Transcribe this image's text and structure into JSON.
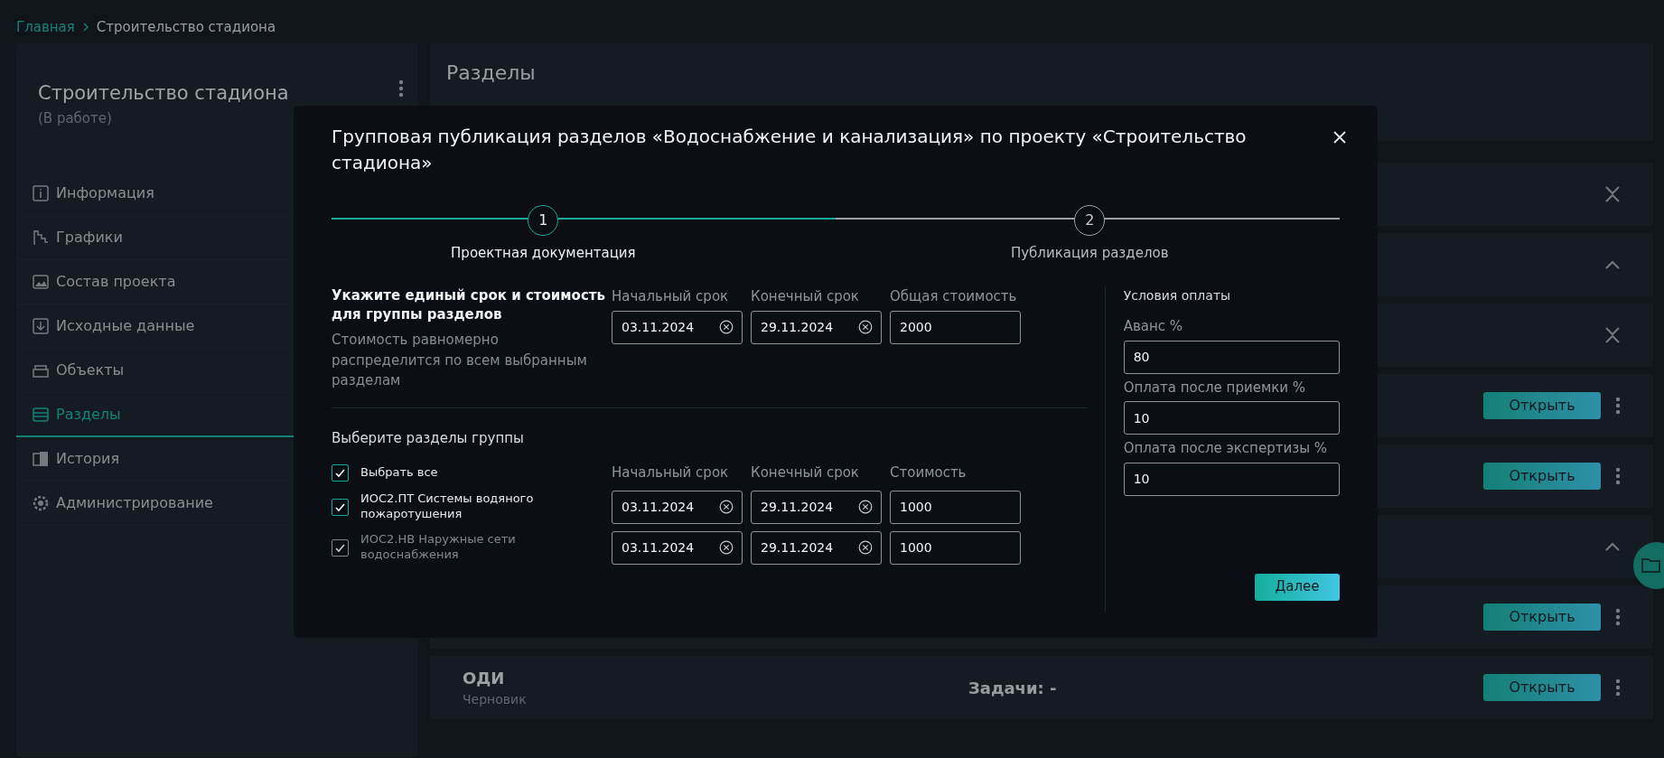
{
  "breadcrumb": [
    {
      "label": "Главная",
      "kind": "link"
    },
    {
      "label": "Строительство стадиона",
      "kind": "current"
    }
  ],
  "sidebar": {
    "title": "Строительство стадиона",
    "status": "(В работе)",
    "items": [
      {
        "label": "Информация",
        "selected": false
      },
      {
        "label": "Графики",
        "selected": false
      },
      {
        "label": "Состав проекта",
        "selected": false
      },
      {
        "label": "Исходные данные",
        "selected": false
      },
      {
        "label": "Объекты",
        "selected": false
      },
      {
        "label": "Разделы",
        "selected": true
      },
      {
        "label": "История",
        "selected": false
      },
      {
        "label": "Администрирование",
        "selected": false
      }
    ]
  },
  "main": {
    "title": "Разделы",
    "rows": [
      {
        "kind": "group",
        "expanded": false
      },
      {
        "kind": "group",
        "expanded": true
      },
      {
        "kind": "group",
        "expanded": false
      },
      {
        "kind": "section",
        "button": "Открыть"
      },
      {
        "kind": "section",
        "button": "Открыть"
      },
      {
        "kind": "group",
        "expanded": true
      },
      {
        "kind": "section",
        "button": "Открыть"
      },
      {
        "kind": "section",
        "name": "ОДИ",
        "status": "Черновик",
        "tasks": "Задачи: -",
        "button": "Открыть"
      }
    ]
  },
  "dialog": {
    "title": "Групповая публикация разделов «Водоснабжение и канализация» по проекту «Строительство стадиона»",
    "steps": [
      {
        "number": "1",
        "label": "Проектная документация",
        "selected": true
      },
      {
        "number": "2",
        "label": "Публикация разделов",
        "selected": false
      }
    ],
    "common": {
      "heading": "Укажите единый срок и стоимость для группы разделов",
      "note": "Стоимость равномерно распределится по всем выбранным разделам",
      "fields": [
        {
          "label": "Начальный срок",
          "value": "03.11.2024",
          "kind": "date"
        },
        {
          "label": "Конечный срок",
          "value": "29.11.2024",
          "kind": "date"
        },
        {
          "label": "Общая стоимость",
          "value": "2000",
          "kind": "number"
        }
      ]
    },
    "selection": {
      "heading": "Выберите разделы группы",
      "select_all": {
        "label": "Выбрать все",
        "checked": true
      },
      "columns": [
        "Начальный срок",
        "Конечный срок",
        "Стоимость"
      ],
      "rows": [
        {
          "label": "ИОС2.ПТ Системы водяного пожаротушения",
          "checked": true,
          "disabled": false,
          "start": "03.11.2024",
          "end": "29.11.2024",
          "cost": "1000"
        },
        {
          "label": "ИОС2.НВ Наружные сети водоснабжения",
          "checked": true,
          "disabled": true,
          "start": "03.11.2024",
          "end": "29.11.2024",
          "cost": "1000"
        }
      ]
    },
    "payment": {
      "heading": "Условия оплаты",
      "fields": [
        {
          "label": "Аванс %",
          "value": "80"
        },
        {
          "label": "Оплата после приемки %",
          "value": "10"
        },
        {
          "label": "Оплата после экспертизы %",
          "value": "10"
        }
      ]
    },
    "next_button": "Далее"
  }
}
